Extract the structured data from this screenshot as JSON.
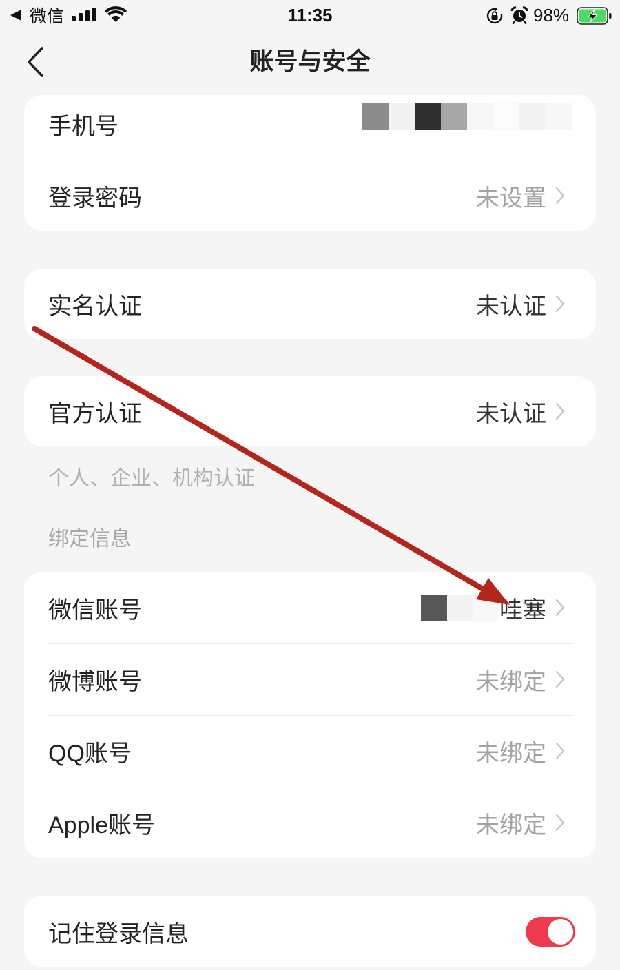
{
  "status_bar": {
    "back_app_label": "微信",
    "time": "11:35",
    "battery_text": "98%",
    "icons": [
      "back-arrow-icon",
      "signal-icon",
      "wifi-icon",
      "rotation-lock-icon",
      "alarm-icon",
      "battery-charging-icon"
    ]
  },
  "nav": {
    "title": "账号与安全",
    "back_icon": "chevron-left-icon"
  },
  "account": {
    "phone": {
      "label": "手机号"
    },
    "password": {
      "label": "登录密码",
      "value": "未设置"
    }
  },
  "verification": {
    "real_name": {
      "label": "实名认证",
      "value": "未认证"
    },
    "official": {
      "label": "官方认证",
      "value": "未认证"
    },
    "hint": "个人、企业、机构认证"
  },
  "binding": {
    "section_title": "绑定信息",
    "wechat": {
      "label": "微信账号",
      "value": "哇塞"
    },
    "weibo": {
      "label": "微博账号",
      "value": "未绑定"
    },
    "qq": {
      "label": "QQ账号",
      "value": "未绑定"
    },
    "apple": {
      "label": "Apple账号",
      "value": "未绑定"
    }
  },
  "remember_login": {
    "label": "记住登录信息",
    "enabled": true
  },
  "colors": {
    "background": "#f5f5f5",
    "accent": "#ef3a4e",
    "annotation": "#b3261e",
    "battery": "#4cd964"
  }
}
